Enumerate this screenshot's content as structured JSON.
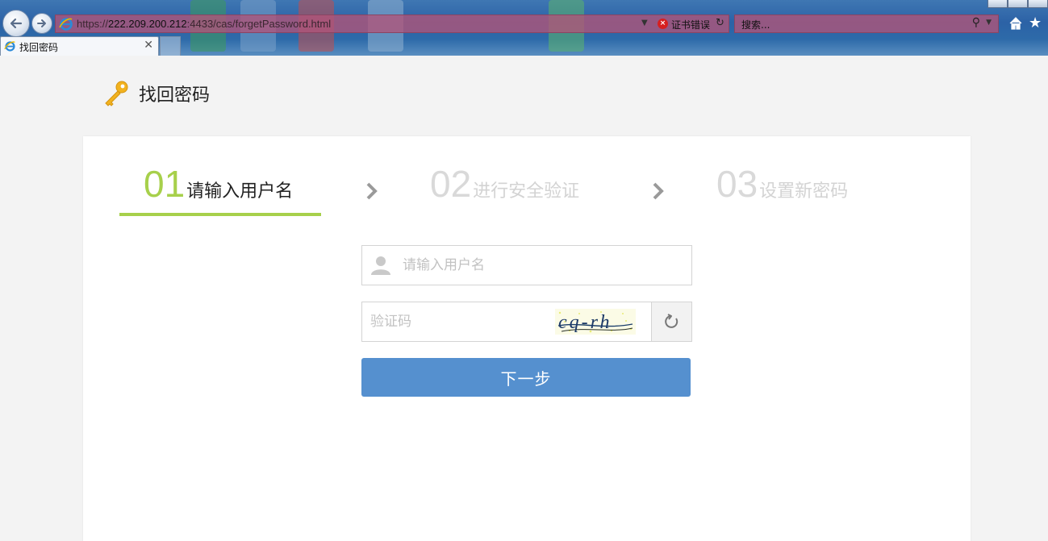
{
  "browser": {
    "url_prefix": "https://",
    "url_host": "222.209.200.212",
    "url_rest": ":4433/cas/forgetPassword.html",
    "cert_error_label": "证书错误",
    "search_placeholder": "搜索...",
    "tab_title": "找回密码"
  },
  "page": {
    "title": "找回密码"
  },
  "steps": [
    {
      "num": "01",
      "label": "请输入用户名",
      "state": "active"
    },
    {
      "num": "02",
      "label": "进行安全验证",
      "state": "inactive"
    },
    {
      "num": "03",
      "label": "设置新密码",
      "state": "inactive"
    }
  ],
  "form": {
    "username_placeholder": "请输入用户名",
    "captcha_placeholder": "验证码",
    "captcha_text": "cq-rh",
    "submit_label": "下一步"
  },
  "colors": {
    "active_step": "#a7d04b",
    "inactive_step": "#d9d9d9",
    "button": "#5590cf",
    "page_bg": "#f3f3f3"
  }
}
